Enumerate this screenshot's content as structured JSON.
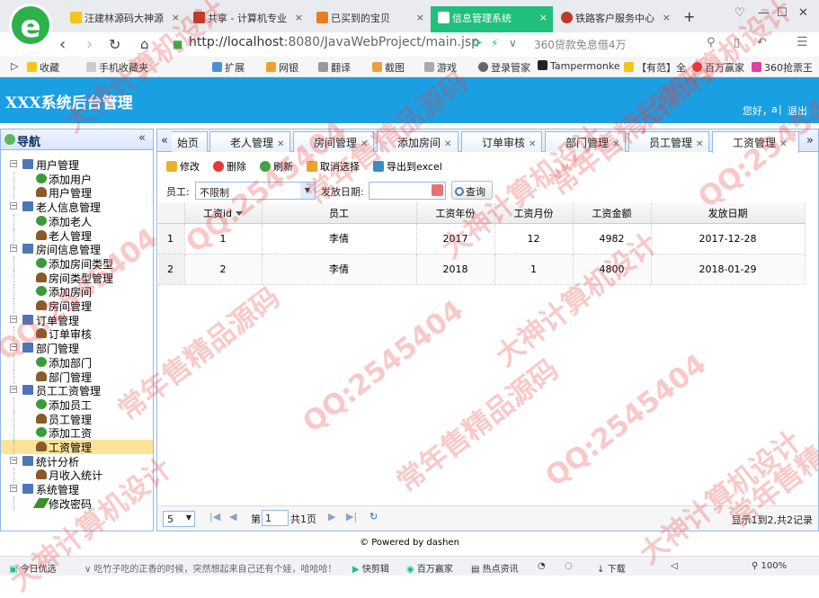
{
  "browser": {
    "tabs": [
      {
        "label": "汪建林源码大神源",
        "color": "#f5c518"
      },
      {
        "label": "共享 - 计算机专业",
        "color": "#c0392b"
      },
      {
        "label": "已买到的宝贝",
        "color": "#e67e22"
      },
      {
        "label": "信息管理系统",
        "color": "#1fbf7c"
      },
      {
        "label": "铁路客户服务中心",
        "color": "#c0392b"
      }
    ],
    "active_tab": 3,
    "new_tab": "+",
    "url_host": "http://localhost",
    "url_rest": ":8080/JavaWebProject/main.jsp",
    "search_hint": "360贷款免息借4万",
    "bookmarks": [
      "收藏",
      "手机收藏夹",
      "扩展",
      "网银",
      "翻译",
      "截图",
      "游戏",
      "登录管家",
      "Tampermonke",
      "【有范】全",
      "百万赢家",
      "360抢票王"
    ]
  },
  "header": {
    "title": "XXX系统后台管理",
    "greeting": "您好，",
    "user": "a",
    "logout": "退出"
  },
  "nav": {
    "title": "导航",
    "tree": [
      {
        "label": "用户管理",
        "level": 0
      },
      {
        "label": "添加用户",
        "level": 1,
        "icon": "add"
      },
      {
        "label": "用户管理",
        "level": 1,
        "icon": "user"
      },
      {
        "label": "老人信息管理",
        "level": 0
      },
      {
        "label": "添加老人",
        "level": 1,
        "icon": "add"
      },
      {
        "label": "老人管理",
        "level": 1,
        "icon": "user"
      },
      {
        "label": "房间信息管理",
        "level": 0
      },
      {
        "label": "添加房间类型",
        "level": 1,
        "icon": "add"
      },
      {
        "label": "房间类型管理",
        "level": 1,
        "icon": "user"
      },
      {
        "label": "添加房间",
        "level": 1,
        "icon": "add"
      },
      {
        "label": "房间管理",
        "level": 1,
        "icon": "user"
      },
      {
        "label": "订单管理",
        "level": 0
      },
      {
        "label": "订单审核",
        "level": 1,
        "icon": "user"
      },
      {
        "label": "部门管理",
        "level": 0
      },
      {
        "label": "添加部门",
        "level": 1,
        "icon": "add"
      },
      {
        "label": "部门管理",
        "level": 1,
        "icon": "user"
      },
      {
        "label": "员工工资管理",
        "level": 0
      },
      {
        "label": "添加员工",
        "level": 1,
        "icon": "add"
      },
      {
        "label": "员工管理",
        "level": 1,
        "icon": "user"
      },
      {
        "label": "添加工资",
        "level": 1,
        "icon": "add"
      },
      {
        "label": "工资管理",
        "level": 1,
        "icon": "user",
        "selected": true
      },
      {
        "label": "统计分析",
        "level": 0
      },
      {
        "label": "月收入统计",
        "level": 1,
        "icon": "user"
      },
      {
        "label": "系统管理",
        "level": 0
      },
      {
        "label": "修改密码",
        "level": 1,
        "icon": "pencil"
      }
    ]
  },
  "panel_tabs": [
    {
      "label": "始页",
      "closable": false
    },
    {
      "label": "老人管理",
      "closable": true
    },
    {
      "label": "房间管理",
      "closable": true
    },
    {
      "label": "添加房间",
      "closable": true
    },
    {
      "label": "订单审核",
      "closable": true
    },
    {
      "label": "部门管理",
      "closable": true
    },
    {
      "label": "员工管理",
      "closable": true
    },
    {
      "label": "工资管理",
      "closable": true,
      "active": true
    }
  ],
  "toolbar": {
    "edit": "修改",
    "delete": "删除",
    "refresh": "刷新",
    "cancel_select": "取消选择",
    "export": "导出到excel"
  },
  "filters": {
    "employee_label": "员工:",
    "employee_value": "不限制",
    "date_label": "发放日期:",
    "date_value": "",
    "query": "查询"
  },
  "table": {
    "columns": [
      "工资id",
      "员工",
      "工资年份",
      "工资月份",
      "工资金额",
      "发放日期"
    ],
    "rows": [
      {
        "n": "1",
        "cells": [
          "1",
          "李倩",
          "2017",
          "12",
          "4982",
          "2017-12-28"
        ]
      },
      {
        "n": "2",
        "cells": [
          "2",
          "李倩",
          "2018",
          "1",
          "4800",
          "2018-01-29"
        ]
      }
    ]
  },
  "pager": {
    "page_size": "5",
    "page_prefix": "第",
    "page": "1",
    "page_suffix": "共1页",
    "info": "显示1到2,共2记录"
  },
  "footer": "© Powered by dashen",
  "statusbar": {
    "left": "今日优选",
    "ticker": "吃竹子吃的正香的时候，突然想起来自己还有个娃，哈哈哈！",
    "items": [
      "快剪辑",
      "百万赢家",
      "热点资讯",
      "下载",
      "100%"
    ]
  },
  "watermark": {
    "lines": [
      "QQ:2545404",
      "常年售精品源码",
      "大神计算机设计"
    ]
  }
}
